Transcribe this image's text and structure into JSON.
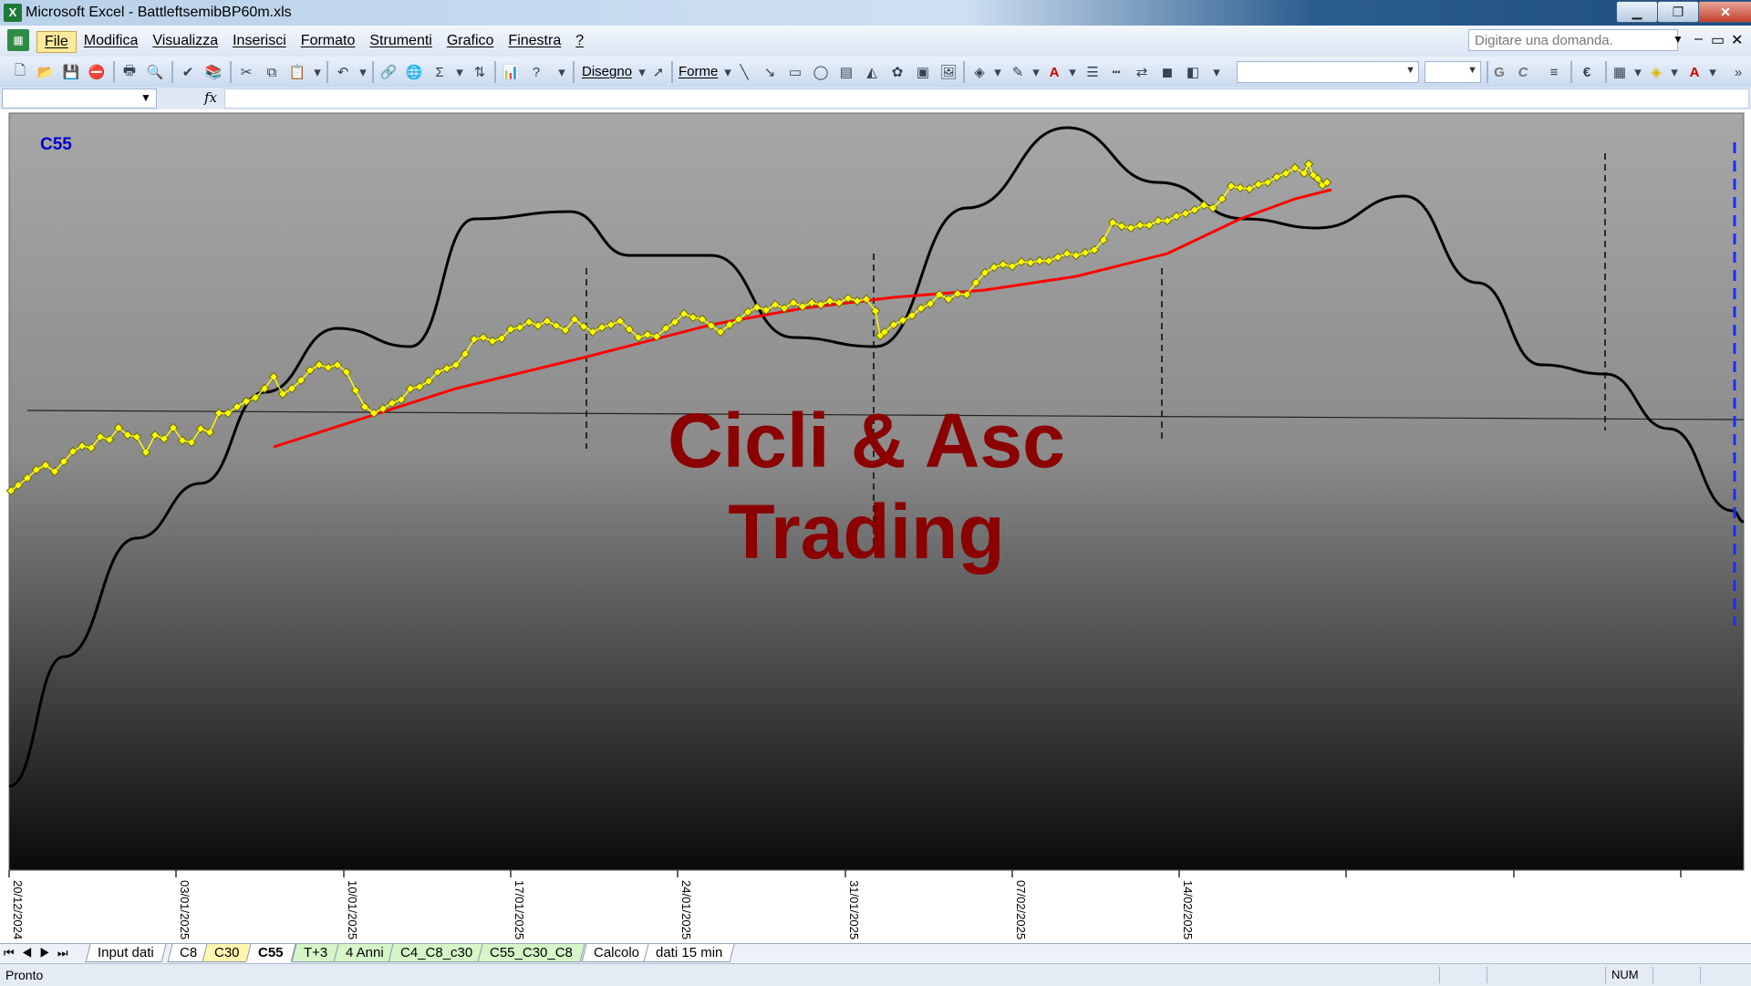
{
  "window": {
    "app_icon": "X",
    "title": "Microsoft Excel - BattleftsemibBP60m.xls",
    "minimize_icon": "minimize-icon",
    "restore_icon": "restore-icon",
    "close_icon": "close-icon"
  },
  "menu": {
    "items": [
      "File",
      "Modifica",
      "Visualizza",
      "Inserisci",
      "Formato",
      "Strumenti",
      "Grafico",
      "Finestra",
      "?"
    ],
    "active": "File",
    "ask_placeholder": "Digitare una domanda.",
    "mdi_minimize": "–",
    "mdi_restore": "▭",
    "mdi_close": "✕"
  },
  "toolbar": {
    "disegno_label": "Disegno",
    "forme_label": "Forme",
    "bold_label": "G",
    "italic_label": "C",
    "euro_label": "€"
  },
  "formula_bar": {
    "fx_label": "fx",
    "name_box_value": "",
    "formula_value": ""
  },
  "chart": {
    "sheet_label": "C55",
    "watermark_line1": "Cicli & Asc",
    "watermark_line2": "Trading",
    "colors": {
      "price": "#ffff00",
      "ma": "#ff0000",
      "cycle": "#000000",
      "label": "#0000cc",
      "watermark": "#8b0000"
    }
  },
  "chart_data": {
    "type": "line",
    "title": "",
    "xlabel": "",
    "ylabel": "",
    "x_tick_labels": [
      "20/12/2024",
      "03/01/2025",
      "10/01/2025",
      "17/01/2025",
      "24/01/2025",
      "31/01/2025",
      "07/02/2025",
      "14/02/2025"
    ],
    "x_count": 160,
    "y_axis": "hidden",
    "grid": false,
    "legend": "none",
    "series": [
      {
        "kind": "price",
        "points": [
          [
            0,
            -18
          ],
          [
            2,
            -16
          ],
          [
            4,
            -13
          ],
          [
            6,
            -12
          ],
          [
            8,
            -9
          ],
          [
            10,
            -6
          ],
          [
            12,
            -4
          ],
          [
            13,
            -2
          ],
          [
            14,
            -5
          ],
          [
            16,
            -3
          ],
          [
            18,
            -6
          ],
          [
            19,
            -1
          ],
          [
            21,
            -3
          ],
          [
            23,
            -4
          ],
          [
            25,
            -2
          ],
          [
            26,
            2
          ],
          [
            28,
            5
          ],
          [
            30,
            7
          ],
          [
            32,
            10
          ],
          [
            34,
            14
          ],
          [
            36,
            17
          ],
          [
            38,
            20
          ],
          [
            40,
            21
          ],
          [
            42,
            21
          ],
          [
            44,
            17
          ],
          [
            46,
            8
          ],
          [
            48,
            8
          ],
          [
            50,
            12
          ],
          [
            52,
            14
          ],
          [
            54,
            17
          ],
          [
            56,
            20
          ],
          [
            58,
            22
          ],
          [
            60,
            26
          ],
          [
            62,
            27
          ],
          [
            64,
            28
          ],
          [
            66,
            30
          ],
          [
            68,
            31
          ],
          [
            70,
            32
          ],
          [
            72,
            30
          ],
          [
            74,
            32
          ],
          [
            76,
            31
          ],
          [
            78,
            29
          ],
          [
            80,
            30
          ],
          [
            82,
            32
          ],
          [
            84,
            31
          ],
          [
            86,
            32
          ],
          [
            88,
            33
          ],
          [
            90,
            33
          ],
          [
            92,
            32
          ],
          [
            94,
            31
          ],
          [
            96,
            31
          ],
          [
            98,
            33
          ],
          [
            100,
            35
          ],
          [
            102,
            36
          ],
          [
            104,
            35
          ],
          [
            106,
            37
          ],
          [
            108,
            38
          ],
          [
            110,
            40
          ],
          [
            112,
            42
          ],
          [
            114,
            44
          ],
          [
            116,
            45
          ],
          [
            118,
            47
          ],
          [
            120,
            49
          ],
          [
            122,
            48
          ],
          [
            124,
            50
          ],
          [
            126,
            53
          ],
          [
            128,
            54
          ],
          [
            130,
            53
          ],
          [
            132,
            55
          ],
          [
            134,
            57
          ],
          [
            136,
            59
          ],
          [
            138,
            59
          ],
          [
            140,
            60
          ],
          [
            142,
            62
          ],
          [
            144,
            64
          ],
          [
            146,
            65
          ],
          [
            148,
            66
          ],
          [
            150,
            68
          ],
          [
            152,
            68
          ],
          [
            154,
            67
          ],
          [
            156,
            70
          ],
          [
            158,
            72
          ],
          [
            160,
            71
          ],
          [
            162,
            73
          ],
          [
            164,
            73
          ],
          [
            166,
            75
          ],
          [
            168,
            77
          ],
          [
            170,
            80
          ],
          [
            172,
            82
          ],
          [
            174,
            84
          ],
          [
            176,
            86
          ],
          [
            178,
            88
          ],
          [
            180,
            89
          ],
          [
            182,
            90
          ],
          [
            184,
            91
          ],
          [
            186,
            92
          ],
          [
            188,
            93
          ],
          [
            190,
            94
          ],
          [
            192,
            95
          ],
          [
            194,
            96
          ],
          [
            196,
            97
          ],
          [
            198,
            98
          ],
          [
            200,
            99
          ],
          [
            202,
            100
          ],
          [
            204,
            101
          ],
          [
            206,
            102
          ],
          [
            208,
            103
          ],
          [
            210,
            104
          ],
          [
            212,
            105
          ],
          [
            214,
            106
          ],
          [
            216,
            107
          ],
          [
            218,
            108
          ],
          [
            220,
            110
          ],
          [
            222,
            112
          ],
          [
            224,
            115
          ],
          [
            226,
            118
          ],
          [
            228,
            121
          ],
          [
            229,
            124
          ],
          [
            230,
            128
          ],
          [
            232,
            130
          ],
          [
            234,
            132
          ],
          [
            236,
            134
          ],
          [
            238,
            136
          ],
          [
            240,
            138
          ],
          [
            242,
            140
          ],
          [
            244,
            141
          ],
          [
            246,
            142
          ],
          [
            248,
            143
          ],
          [
            250,
            144
          ],
          [
            252,
            145
          ],
          [
            254,
            146
          ],
          [
            256,
            148
          ],
          [
            258,
            150
          ],
          [
            260,
            152
          ],
          [
            262,
            154
          ],
          [
            264,
            155
          ],
          [
            266,
            156
          ],
          [
            268,
            157
          ],
          [
            270,
            158
          ],
          [
            272,
            159
          ],
          [
            274,
            160
          ],
          [
            276,
            161
          ],
          [
            278,
            162
          ],
          [
            280,
            164
          ],
          [
            282,
            166
          ],
          [
            284,
            168
          ],
          [
            286,
            170
          ],
          [
            288,
            172
          ],
          [
            290,
            174
          ],
          [
            292,
            176
          ],
          [
            294,
            178
          ],
          [
            296,
            180
          ],
          [
            298,
            182
          ],
          [
            300,
            184
          ],
          [
            302,
            186
          ],
          [
            304,
            188
          ],
          [
            306,
            190
          ],
          [
            308,
            192
          ],
          [
            310,
            194
          ],
          [
            312,
            196
          ],
          [
            314,
            198
          ],
          [
            316,
            200
          ],
          [
            318,
            202
          ],
          [
            320,
            204
          ],
          [
            322,
            206
          ],
          [
            324,
            208
          ],
          [
            326,
            210
          ],
          [
            328,
            212
          ],
          [
            330,
            214
          ],
          [
            332,
            216
          ],
          [
            334,
            218
          ],
          [
            336,
            219
          ],
          [
            338,
            220
          ],
          [
            340,
            221
          ],
          [
            342,
            222
          ],
          [
            344,
            223
          ]
        ]
      }
    ]
  },
  "sheets": {
    "tabs": [
      {
        "label": "Input dati",
        "style": "plain"
      },
      {
        "label": "C8",
        "style": "plain"
      },
      {
        "label": "C30",
        "style": "yellow"
      },
      {
        "label": "C55",
        "style": "active"
      },
      {
        "label": "T+3",
        "style": "green"
      },
      {
        "label": "4 Anni",
        "style": "green"
      },
      {
        "label": "C4_C8_c30",
        "style": "green"
      },
      {
        "label": "C55_C30_C8",
        "style": "green"
      },
      {
        "label": "Calcolo",
        "style": "plain"
      },
      {
        "label": "dati 15 min",
        "style": "plain"
      }
    ],
    "nav_icons": [
      "first-sheet-icon",
      "prev-sheet-icon",
      "next-sheet-icon",
      "last-sheet-icon"
    ]
  },
  "status": {
    "ready": "Pronto",
    "num": "NUM"
  }
}
